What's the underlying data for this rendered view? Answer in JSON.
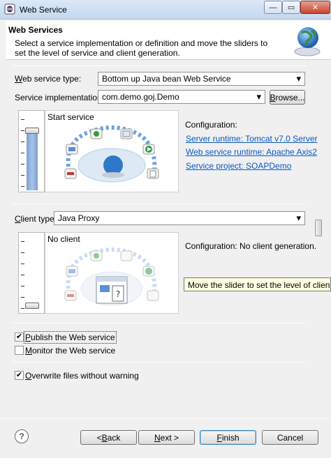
{
  "window": {
    "title": "Web Service",
    "min_glyph": "—",
    "max_glyph": "▭",
    "close_glyph": "✕"
  },
  "header": {
    "title": "Web Services",
    "description": "Select a service implementation or definition and move the sliders to set the level of service and client generation."
  },
  "service": {
    "type_label_prefix": "",
    "type_label_u": "W",
    "type_label_rest": "eb service type:",
    "type_value": "Bottom up Java bean Web Service",
    "impl_label": "Service implementation:",
    "impl_value": "com.demo.goj.Demo",
    "browse_label_u": "B",
    "browse_label_rest": "rowse...",
    "slider_level": "Start service",
    "config_title": "Configuration:",
    "links": [
      "Server runtime: Tomcat v7.0 Server",
      "Web service runtime: Apache Axis2",
      "Service project: SOAPDemo"
    ]
  },
  "client": {
    "type_label_u": "C",
    "type_label_rest": "lient type:",
    "type_value": "Java Proxy",
    "slider_level": "No client",
    "config_text": "Configuration: No client generation.",
    "tooltip": "Move the slider to set the level of client generation."
  },
  "options": {
    "publish_u": "P",
    "publish_rest": "ublish the Web service",
    "publish_checked": true,
    "monitor_u": "M",
    "monitor_rest": "onitor the Web service",
    "monitor_checked": false,
    "overwrite_u": "O",
    "overwrite_rest": "verwrite files without warning",
    "overwrite_checked": true
  },
  "buttons": {
    "back_prefix": "< ",
    "back_u": "B",
    "back_rest": "ack",
    "next_u": "N",
    "next_rest": "ext >",
    "finish_u": "F",
    "finish_rest": "inish",
    "cancel": "Cancel",
    "help_glyph": "?"
  },
  "icons": {
    "dropdown": "▾",
    "check": "✔"
  }
}
